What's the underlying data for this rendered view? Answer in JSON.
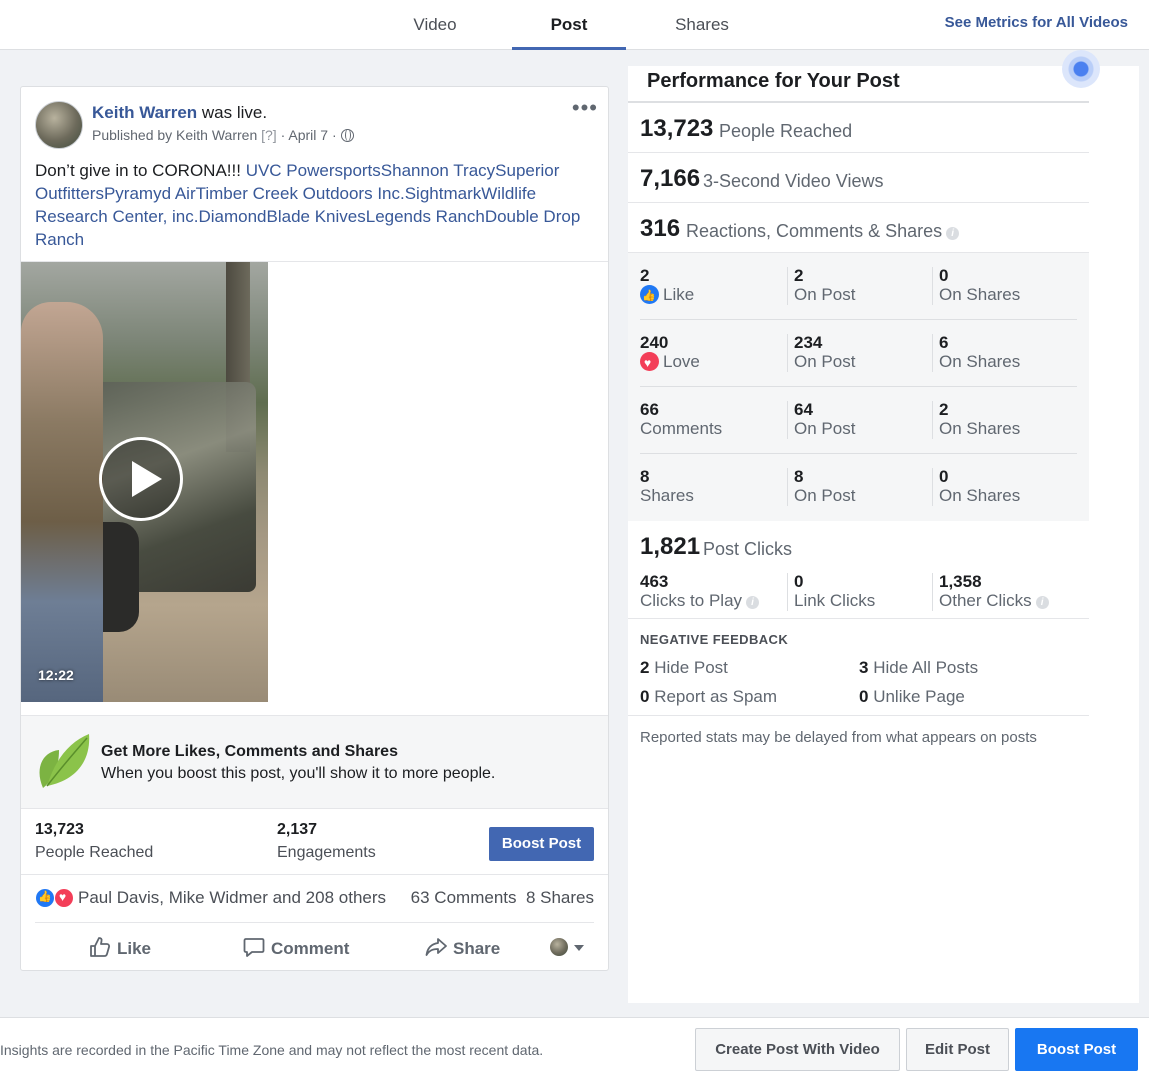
{
  "tabs": [
    {
      "label": "Video"
    },
    {
      "label": "Post"
    },
    {
      "label": "Shares"
    }
  ],
  "see_metrics_link": "See Metrics for All Videos",
  "post": {
    "author": "Keith Warren",
    "action": " was live.",
    "published_by": "Published by Keith Warren",
    "help_marker": "[?]",
    "date": "April 7",
    "more_icon": "more-dots-icon",
    "text_intro": "Don’t give in to CORONA!!! ",
    "tags": [
      "UVC Powersports",
      "Shannon Tracy",
      "Superior Outfitters",
      "Pyramyd Air",
      "Timber Creek Outdoors Inc.",
      "Sightmark",
      "Wildlife Research Center, inc.",
      "DiamondBlade Knives",
      "Legends Ranch",
      "Double Drop Ranch"
    ],
    "video_duration": "12:22",
    "promo_title": "Get More Likes, Comments and Shares",
    "promo_subtitle": "When you boost this post, you'll show it to more people.",
    "stats": [
      {
        "value": "13,723",
        "label": "People Reached"
      },
      {
        "value": "2,137",
        "label": "Engagements"
      }
    ],
    "boost_label": "Boost Post",
    "reactors": "Paul Davis, Mike Widmer and 208 others",
    "comments_count": "63 Comments",
    "shares_count": "8 Shares",
    "actions": {
      "like": "Like",
      "comment": "Comment",
      "share": "Share"
    }
  },
  "performance": {
    "title": "Performance for Your Post",
    "headline": [
      {
        "value": "13,723",
        "label": "People Reached"
      },
      {
        "value": "7,166",
        "label": "3-Second Video Views"
      },
      {
        "value": "316",
        "label": "Reactions, Comments & Shares"
      }
    ],
    "breakdown": [
      {
        "total": "2",
        "label": "Like",
        "on_post": "2",
        "on_shares": "0"
      },
      {
        "total": "240",
        "label": "Love",
        "on_post": "234",
        "on_shares": "6"
      },
      {
        "total": "66",
        "label": "Comments",
        "on_post": "64",
        "on_shares": "2"
      },
      {
        "total": "8",
        "label": "Shares",
        "on_post": "8",
        "on_shares": "0"
      }
    ],
    "on_post_label": "On Post",
    "on_shares_label": "On Shares",
    "post_clicks": {
      "value": "1,821",
      "label": "Post Clicks"
    },
    "clicks": [
      {
        "value": "463",
        "label": "Clicks to Play"
      },
      {
        "value": "0",
        "label": "Link Clicks"
      },
      {
        "value": "1,358",
        "label": "Other Clicks"
      }
    ],
    "negative_title": "NEGATIVE FEEDBACK",
    "negative": [
      {
        "value": "2",
        "label": "Hide Post"
      },
      {
        "value": "3",
        "label": "Hide All Posts"
      },
      {
        "value": "0",
        "label": "Report as Spam"
      },
      {
        "value": "0",
        "label": "Unlike Page"
      }
    ],
    "delay_note": "Reported stats may be delayed from what appears on posts"
  },
  "footer": {
    "note": "Insights are recorded in the Pacific Time Zone and may not reflect the most recent data.",
    "create_post": "Create Post With Video",
    "edit_post": "Edit Post",
    "boost_post": "Boost Post"
  },
  "colors": {
    "accent": "#4267b2",
    "link": "#385898",
    "primary_button": "#1877f2",
    "like": "#2078f4",
    "love": "#f33e58"
  }
}
